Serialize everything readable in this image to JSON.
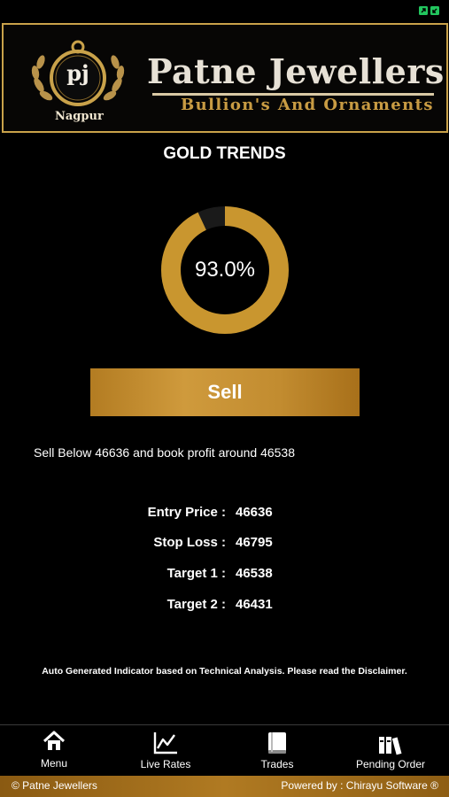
{
  "brand": {
    "title": "Patne Jewellers",
    "subtitle": "Bullion's And Ornaments",
    "city": "Nagpur",
    "logo_monogram": "pj"
  },
  "page": {
    "title": "GOLD TRENDS"
  },
  "trend": {
    "percent_value": 0.93,
    "percent_label": "93.0%",
    "action_label": "Sell",
    "advice": "Sell Below 46636 and book profit around 46538"
  },
  "levels": [
    {
      "label": "Entry Price :",
      "value": "46636"
    },
    {
      "label": "Stop Loss :",
      "value": "46795"
    },
    {
      "label": "Target 1 :",
      "value": "46538"
    },
    {
      "label": "Target 2 :",
      "value": "46431"
    }
  ],
  "disclaimer": "Auto Generated Indicator based on Technical Analysis. Please read the Disclaimer.",
  "tabs": [
    {
      "label": "Menu",
      "icon": "home-icon"
    },
    {
      "label": "Live Rates",
      "icon": "chart-icon"
    },
    {
      "label": "Trades",
      "icon": "book-icon"
    },
    {
      "label": "Pending Order",
      "icon": "books-icon"
    }
  ],
  "footer": {
    "left": "© Patne Jewellers",
    "right": "Powered by : Chirayu Software ®"
  },
  "colors": {
    "gold": "#c9962f",
    "gold_border": "#c9a24a",
    "background": "#000000",
    "status_green": "#22c55e"
  }
}
